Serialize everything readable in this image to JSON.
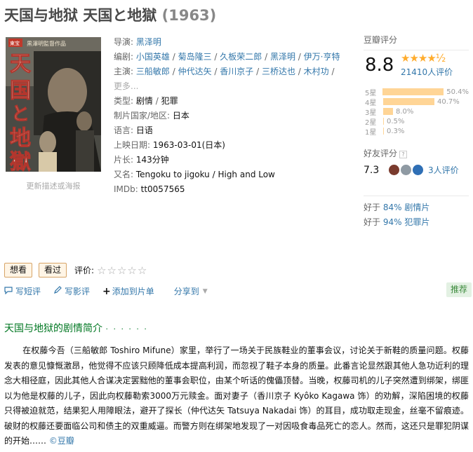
{
  "header": {
    "title": "天国与地狱 天国と地獄",
    "year": "(1963)"
  },
  "poster": {
    "caption": "更新描述或海报",
    "text_chars": [
      "天",
      "国",
      "と",
      "地",
      "獄"
    ],
    "logo_text": "東宝",
    "studio_text": "黒澤明監督作品"
  },
  "info": {
    "director_label": "导演:",
    "director": "黑泽明",
    "writer_label": "编剧:",
    "writers": [
      "小国英雄",
      "菊岛隆三",
      "久板荣二郎",
      "黑泽明",
      "伊万·亨特"
    ],
    "cast_label": "主演:",
    "cast": [
      "三船敏郎",
      "仲代达矢",
      "香川京子",
      "三桥达也",
      "木村功"
    ],
    "cast_more": "更多...",
    "genre_label": "类型:",
    "genres": [
      "剧情",
      "犯罪"
    ],
    "country_label": "制片国家/地区:",
    "country": "日本",
    "language_label": "语言:",
    "language": "日语",
    "release_label": "上映日期:",
    "release": "1963-03-01(日本)",
    "runtime_label": "片长:",
    "runtime": "143分钟",
    "aka_label": "又名:",
    "aka": "Tengoku to jigoku / High and Low",
    "imdb_label": "IMDb:",
    "imdb": "tt0057565"
  },
  "rating": {
    "head": "豆瓣评分",
    "score": "8.8",
    "stars": "★★★★½",
    "votes": "21410人评价",
    "distribution": [
      {
        "label": "5星",
        "percent": "50.4%",
        "value": 50.4
      },
      {
        "label": "4星",
        "percent": "40.7%",
        "value": 40.7
      },
      {
        "label": "3星",
        "percent": "8.0%",
        "value": 8.0
      },
      {
        "label": "2星",
        "percent": "0.5%",
        "value": 0.5
      },
      {
        "label": "1星",
        "percent": "0.3%",
        "value": 0.3
      }
    ],
    "friend_head": "好友评分",
    "friend_q": "?",
    "friend_score": "7.3",
    "friend_votes": "3人评价",
    "better_than": [
      {
        "prefix": "好于",
        "percent": "84%",
        "genre": "剧情片"
      },
      {
        "prefix": "好于",
        "percent": "94%",
        "genre": "犯罪片"
      }
    ]
  },
  "actions": {
    "want": "想看",
    "seen": "看过",
    "rate_label": "评价:",
    "rate_stars": "☆☆☆☆☆"
  },
  "ops": {
    "short_review": "写短评",
    "review": "写影评",
    "add_list": "添加到片单",
    "share": "分享到",
    "recommend": "推荐"
  },
  "summary": {
    "title": "天国与地狱的剧情简介",
    "dots": "· · · · · ·",
    "text": "在权藤今吾（三船敏郎 Toshiro Mifune）家里，举行了一场关于民族鞋业的董事会议，讨论关于新鞋的质量问题。权藤发表的意见慷慨激昂，他觉得不应该只顾降低成本提高利润，而忽视了鞋子本身的质量。此番言论显然跟其他人急功近利的理念大相径庭，因此其他人合谋决定罢黜他的董事会职位，由某个听话的傀儡顶替。当晚，权藤司机的儿子突然遭到绑架，绑匪以为他是权藤的儿子，因此向权藤勒索3000万元赎金。面对妻子（香川京子 Kyôko Kagawa 饰）的劝解，深陷困境的权藤只得被迫就范，结果犯人用障眼法，避开了探长（仲代达矢 Tatsuya Nakadai 饰）的耳目，成功取走现金，丝毫不留痕迹。破财的权藤还要面临公司和债主的双重威逼。而警方则在绑架地发现了一对因吸食毒品死亡的恋人。然而，这还只是罪犯阴谋的开始……",
    "source": "©豆瓣"
  },
  "colors": {
    "link": "#3377aa",
    "star": "#ffac2d",
    "bar": "#ffd596",
    "green": "#007722"
  }
}
